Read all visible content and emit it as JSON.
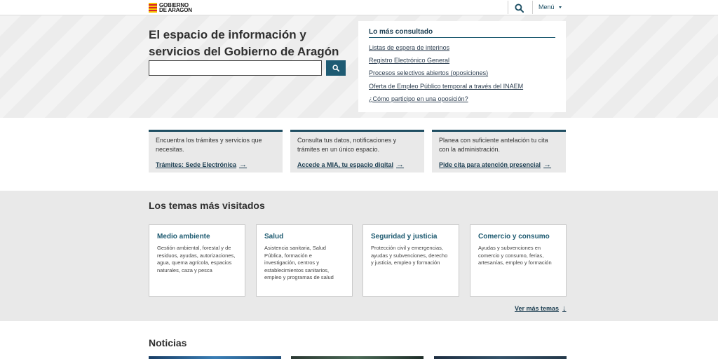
{
  "header": {
    "logo_line1": "GOBIERNO",
    "logo_line2": "DE ARAGON",
    "menu_label": "Menú"
  },
  "hero": {
    "title": "El espacio de información y servicios del Gobierno de Aragón",
    "search_value": "",
    "search_placeholder": ""
  },
  "popular": {
    "title": "Lo más consultado",
    "links": [
      "Listas de espera de interinos",
      "Registro Electrónico General",
      "Procesos selectivos abiertos (oposiciones)",
      "Oferta de Empleo Público temporal a través del INAEM",
      "¿Cómo participo en una oposición?"
    ]
  },
  "cards": [
    {
      "text": "Encuentra los trámites y servicios que necesitas.",
      "link": "Trámites: Sede Electrónica"
    },
    {
      "text": "Consulta tus datos, notificaciones y trámites en un único espacio.",
      "link": "Accede a MIA, tu espacio digital"
    },
    {
      "text": "Planea con suficiente antelación tu cita con la administración.",
      "link": "Pide cita para atención presencial"
    }
  ],
  "topics": {
    "title": "Los temas más visitados",
    "items": [
      {
        "title": "Medio ambiente",
        "desc": "Gestión ambiental, forestal y de residuos, ayudas, autorizaciones, agua, quema agrícola, espacios naturales, caza y pesca"
      },
      {
        "title": "Salud",
        "desc": "Asistencia sanitaria, Salud Pública, formación e investigación, centros y establecimientos sanitarios, empleo y programas de salud"
      },
      {
        "title": "Seguridad y justicia",
        "desc": "Protección civil y emergencias, ayudas y subvenciones, derecho y justicia, empleo y formación"
      },
      {
        "title": "Comercio y consumo",
        "desc": "Ayudas y subvenciones en comercio y consumo, ferias, artesanías, empleo y formación"
      }
    ],
    "more_label": "Ver más temas",
    "more_arrow": "↓"
  },
  "news": {
    "title": "Noticias"
  },
  "icons": {
    "arrow_right": "→"
  },
  "colors": {
    "brand_dark": "#1d4f64",
    "accent_button": "#1e5b73",
    "band_gray": "#e9e9e9"
  }
}
